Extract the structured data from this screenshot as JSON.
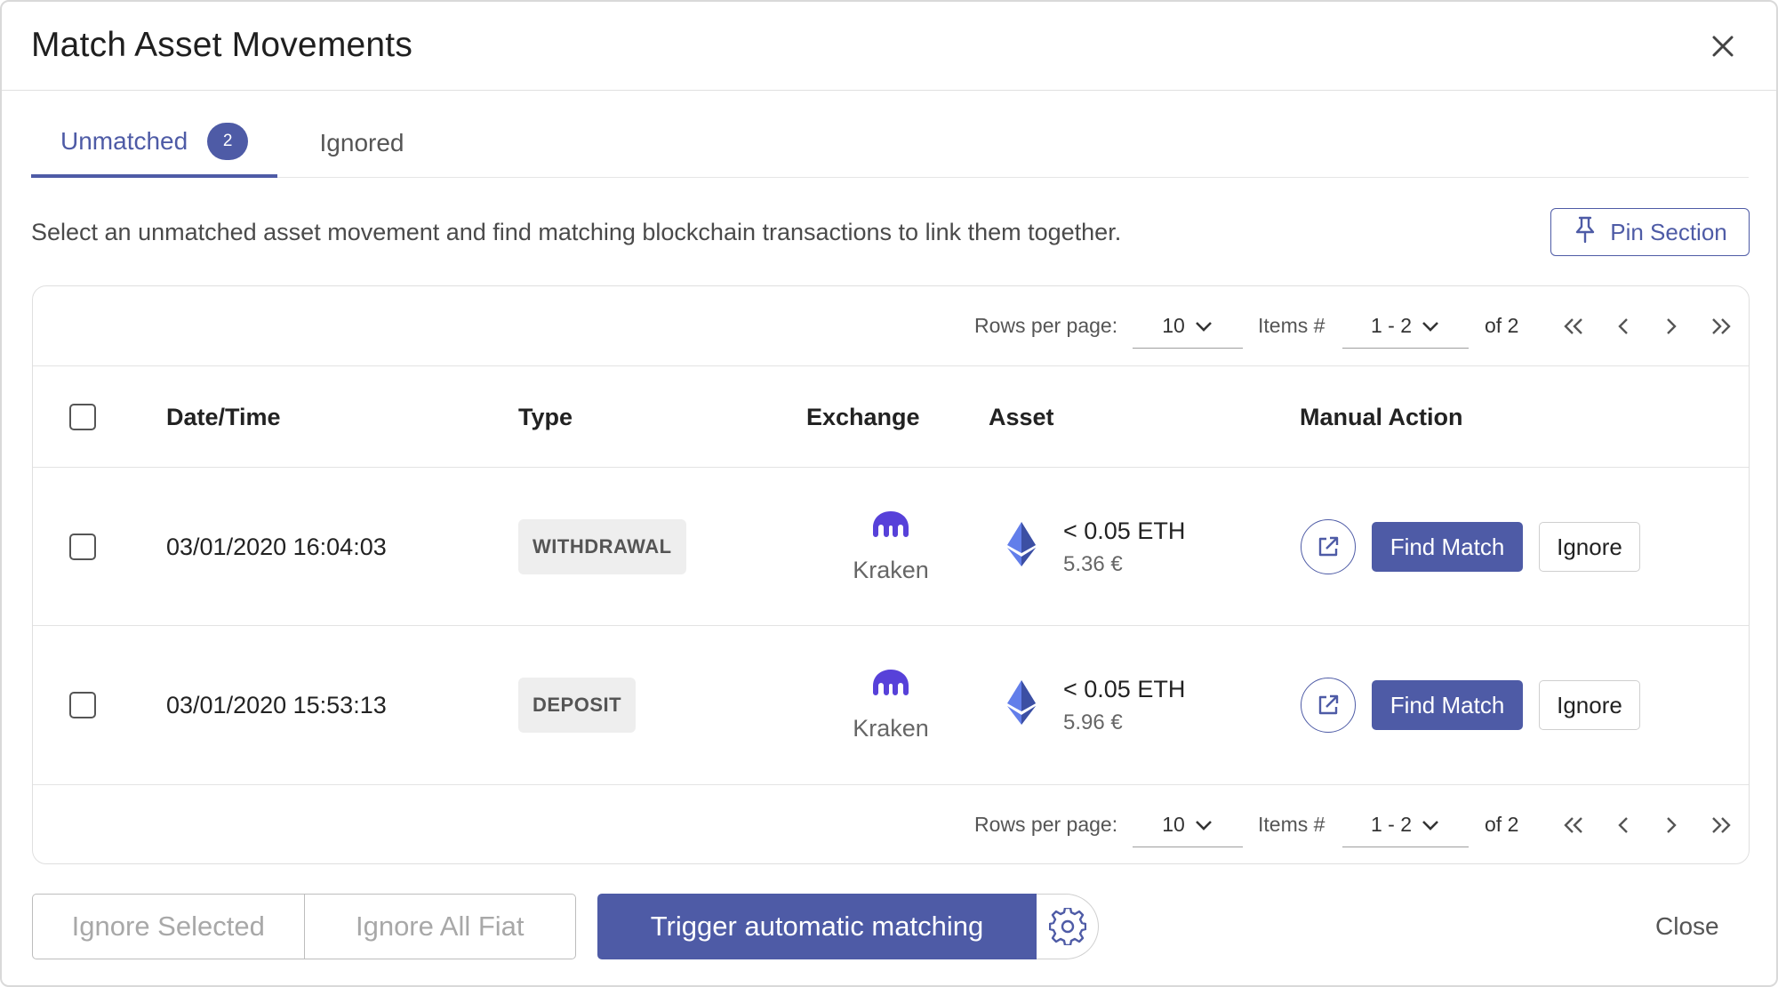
{
  "dialog": {
    "title": "Match Asset Movements",
    "close_icon": "close-icon"
  },
  "tabs": [
    {
      "label": "Unmatched",
      "badge": "2",
      "active": true
    },
    {
      "label": "Ignored",
      "active": false
    }
  ],
  "description": "Select an unmatched asset movement and find matching blockchain transactions to link them together.",
  "pin_button": {
    "label": "Pin Section",
    "icon": "pin-icon"
  },
  "pagination": {
    "rows_per_page_label": "Rows per page:",
    "rows_per_page_value": "10",
    "items_label": "Items #",
    "items_range": "1 - 2",
    "total": "of 2"
  },
  "table": {
    "columns": [
      "Date/Time",
      "Type",
      "Exchange",
      "Asset",
      "Manual Action"
    ],
    "rows": [
      {
        "datetime": "03/01/2020 16:04:03",
        "type": "WITHDRAWAL",
        "exchange": "Kraken",
        "asset_amount": "< 0.05 ETH",
        "asset_fiat": "5.36 €",
        "find_match_label": "Find Match",
        "ignore_label": "Ignore"
      },
      {
        "datetime": "03/01/2020 15:53:13",
        "type": "DEPOSIT",
        "exchange": "Kraken",
        "asset_amount": "< 0.05 ETH",
        "asset_fiat": "5.96 €",
        "find_match_label": "Find Match",
        "ignore_label": "Ignore"
      }
    ]
  },
  "footer": {
    "ignore_selected": "Ignore Selected",
    "ignore_all_fiat": "Ignore All Fiat",
    "trigger": "Trigger automatic matching",
    "close": "Close"
  },
  "colors": {
    "primary": "#4e5ba6",
    "kraken": "#5741d9",
    "eth": "#627eea"
  }
}
